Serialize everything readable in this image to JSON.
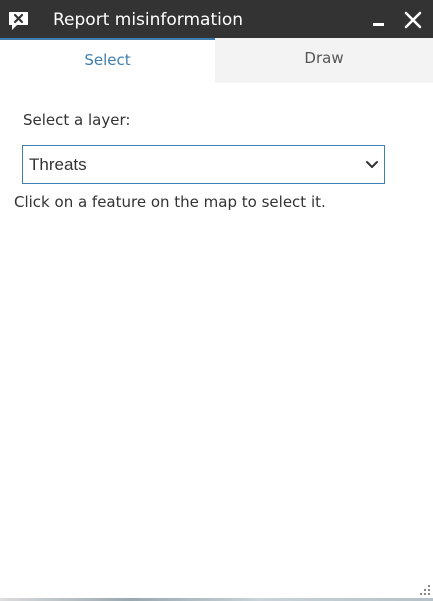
{
  "window": {
    "title": "Report misinformation",
    "icon": "report-flag-icon",
    "minimize_icon": "minimize-icon",
    "close_icon": "close-icon"
  },
  "tabs": [
    {
      "label": "Select",
      "active": true
    },
    {
      "label": "Draw",
      "active": false
    }
  ],
  "select_panel": {
    "layer_label": "Select a layer:",
    "layer_value": "Threats",
    "hint": "Click on a feature on the map to select it."
  },
  "colors": {
    "titlebar": "#333333",
    "accent": "#3f7eaf",
    "inactive_tab_bg": "#f3f3f3"
  }
}
